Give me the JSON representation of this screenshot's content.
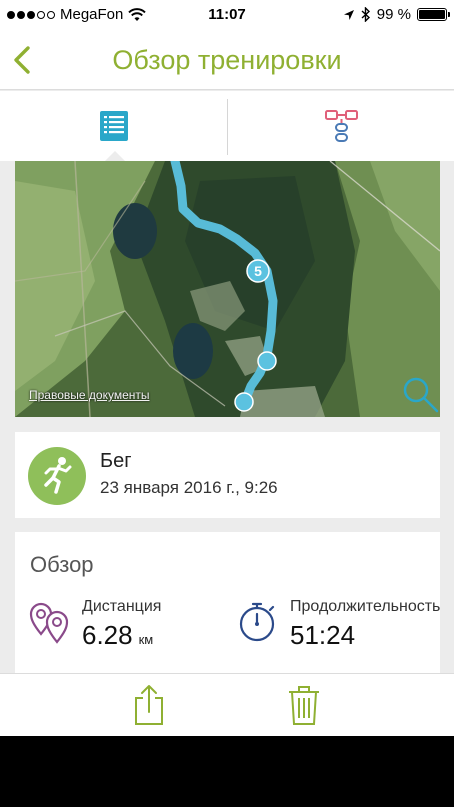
{
  "status_bar": {
    "carrier": "MegaFon",
    "time": "11:07",
    "battery": "99 %",
    "signal_bars_filled": 3,
    "signal_bars_total": 5
  },
  "nav": {
    "title": "Обзор тренировки",
    "back_icon": "chevron-left-icon"
  },
  "tabs": [
    {
      "name": "list",
      "icon": "list-icon",
      "selected": true
    },
    {
      "name": "relations",
      "icon": "relations-icon",
      "selected": false
    }
  ],
  "map": {
    "legal_link": "Правовые документы",
    "marker_label": "5",
    "zoom_icon": "magnifier-icon"
  },
  "activity": {
    "type": "Бег",
    "date": "23 января 2016 г., 9:26",
    "icon": "running-icon"
  },
  "overview": {
    "heading": "Обзор",
    "distance": {
      "label": "Дистанция",
      "value": "6.28",
      "unit": "км",
      "icon": "distance-pin-icon"
    },
    "duration": {
      "label": "Продолжительность",
      "value": "51:24",
      "icon": "stopwatch-icon"
    }
  },
  "toolbar": {
    "share_icon": "share-icon",
    "delete_icon": "trash-icon"
  },
  "colors": {
    "accent_green": "#8fb032",
    "tab_blue": "#2aa7c9",
    "route_blue": "#5bc2e0",
    "run_icon_green": "#8fbf5a",
    "overview_icon_purple": "#8a4a8a",
    "stopwatch_blue": "#2b4a8a"
  }
}
